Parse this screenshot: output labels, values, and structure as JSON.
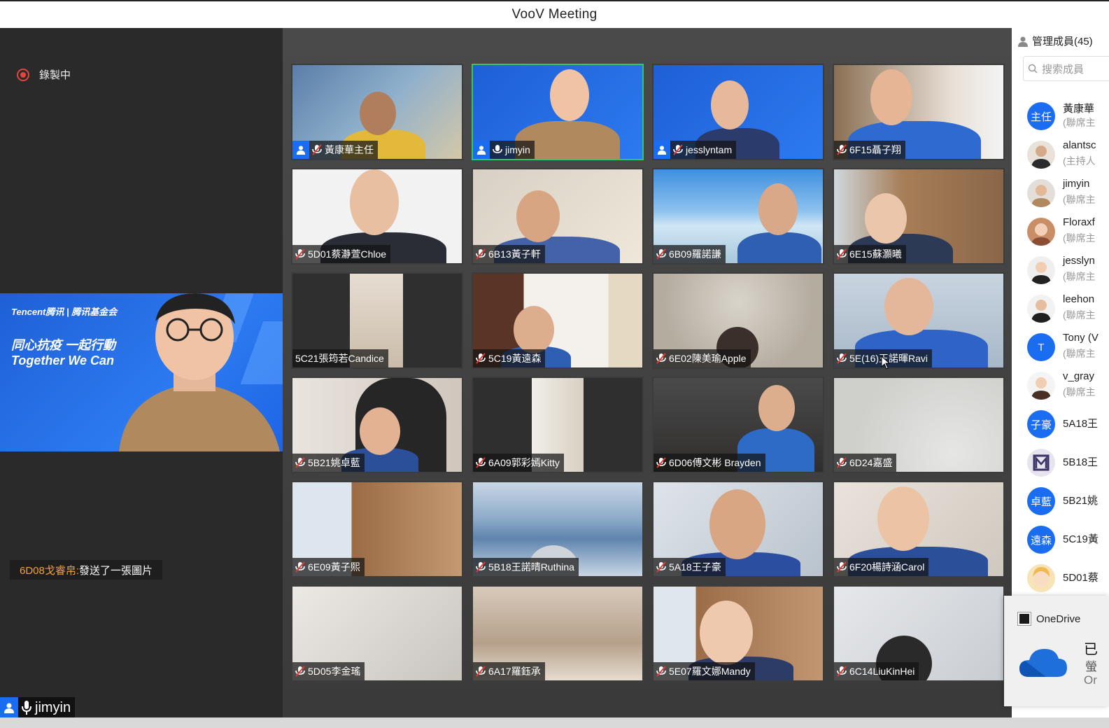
{
  "window": {
    "title": "VooV Meeting"
  },
  "recording": {
    "label": "錄製中"
  },
  "chat_notification": {
    "sender": "6D08戈睿帛:",
    "message": " 發送了一張圖片"
  },
  "self_view": {
    "name": "jimyin"
  },
  "speaker_banner": {
    "brand": "Tencent腾讯 | 腾讯基金会",
    "slogan_cn": "同心抗疫 一起行動",
    "slogan_en": "Together We Can"
  },
  "tiles": [
    {
      "name": "黃康華主任"
    },
    {
      "name": "jimyin"
    },
    {
      "name": "jesslyntam"
    },
    {
      "name": "6F15聶子翔"
    },
    {
      "name": "5D01蔡瀞萱Chloe"
    },
    {
      "name": "6B13黃子軒"
    },
    {
      "name": "6B09羅諾謙"
    },
    {
      "name": "6E15蘇灝曦"
    },
    {
      "name": "5C21張筠若Candice"
    },
    {
      "name": "5C19黃遠森"
    },
    {
      "name": "6E02陳美瑜Apple"
    },
    {
      "name": "5E(16)王諾暉Ravi"
    },
    {
      "name": "5B21姚卓藍"
    },
    {
      "name": "6A09郭彩嫣Kitty"
    },
    {
      "name": "6D06傅文彬 Brayden"
    },
    {
      "name": "6D24嘉盛"
    },
    {
      "name": "6E09黃子熙"
    },
    {
      "name": "5B18王諾晴Ruthina"
    },
    {
      "name": "5A18王子豪"
    },
    {
      "name": "6F20楊詩涵Carol"
    },
    {
      "name": "5D05李金瑤"
    },
    {
      "name": "6A17羅鈺承"
    },
    {
      "name": "5E07羅文娜Mandy"
    },
    {
      "name": "6C14LiuKinHei"
    }
  ],
  "members": {
    "header": "管理成員(45)",
    "search_placeholder": "搜索成員",
    "list": [
      {
        "avatar": "主任",
        "name": "黃康華",
        "role": "(聯席主"
      },
      {
        "avatar": "",
        "name": "alantsc",
        "role": "(主持人"
      },
      {
        "avatar": "",
        "name": "jimyin",
        "role": "(聯席主"
      },
      {
        "avatar": "",
        "name": "Floraxf",
        "role": "(聯席主"
      },
      {
        "avatar": "",
        "name": "jesslyn",
        "role": "(聯席主"
      },
      {
        "avatar": "",
        "name": "leehon",
        "role": "(聯席主"
      },
      {
        "avatar": "T",
        "name": "Tony (V",
        "role": "(聯席主"
      },
      {
        "avatar": "",
        "name": "v_gray",
        "role": "(聯席主"
      },
      {
        "avatar": "子豪",
        "name": "5A18王",
        "role": ""
      },
      {
        "avatar": "",
        "name": "5B18王",
        "role": ""
      },
      {
        "avatar": "卓藍",
        "name": "5B21姚",
        "role": ""
      },
      {
        "avatar": "遠森",
        "name": "5C19黃",
        "role": ""
      },
      {
        "avatar": "",
        "name": "5D01蔡",
        "role": ""
      }
    ]
  },
  "toast": {
    "app": "OneDrive",
    "line1": "已",
    "line2": "螢",
    "line3": "Or"
  }
}
